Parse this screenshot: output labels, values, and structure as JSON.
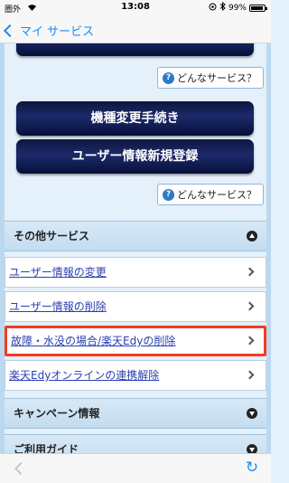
{
  "status_bar": {
    "carrier": "圏外",
    "time": "13:08",
    "battery": "99%"
  },
  "nav": {
    "back_label": "マイ サービス"
  },
  "buttons": {
    "partial_label": "",
    "change_device": "機種変更手続き",
    "register_user": "ユーザー情報新規登録"
  },
  "help": {
    "label": "どんなサービス？",
    "icon": "?"
  },
  "sections": {
    "other_services": "その他サービス",
    "campaign": "キャンペーン情報",
    "guide": "ご利用ガイド"
  },
  "list": {
    "items": [
      {
        "label": "ユーザー情報の変更"
      },
      {
        "label": "ユーザー情報の削除"
      },
      {
        "label": "故障・水没の場合/楽天Edyの削除"
      },
      {
        "label": "楽天Edyオンラインの連携解除"
      }
    ]
  },
  "colors": {
    "accent": "#1a8cf0",
    "highlight": "#ef3e22",
    "button_dark": "#0d1640",
    "link": "#2b3fb0"
  },
  "icons": {
    "reload": "↻"
  }
}
